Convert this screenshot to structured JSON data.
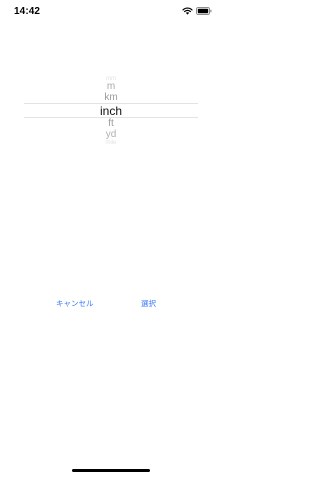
{
  "status_bar": {
    "time": "14:42",
    "icons": [
      "wifi-icon",
      "battery-icon"
    ]
  },
  "picker": {
    "items": [
      "mm",
      "m",
      "km",
      "inch",
      "ft",
      "yd",
      "mile"
    ],
    "selected": "inch"
  },
  "actions": {
    "cancel_label": "キャンセル",
    "select_label": "選択"
  },
  "colors": {
    "accent": "#3478f6",
    "selected_text": "#111111",
    "dim_text": "#9a9a9a"
  }
}
